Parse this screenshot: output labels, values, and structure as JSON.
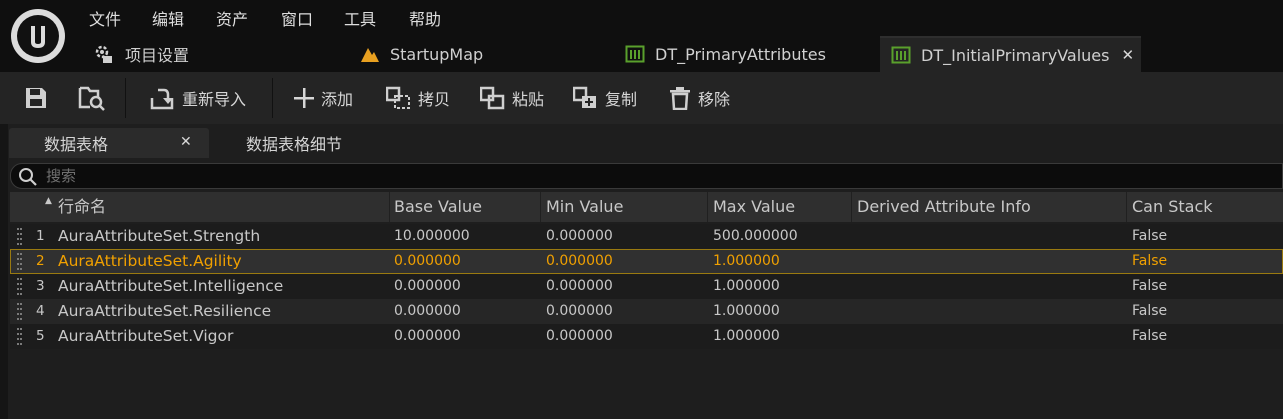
{
  "menubar": {
    "items": [
      "文件",
      "编辑",
      "资产",
      "窗口",
      "工具",
      "帮助"
    ]
  },
  "tabs": [
    {
      "label": "项目设置",
      "icon": "settings-gear-icon"
    },
    {
      "label": "StartupMap",
      "icon": "level-map-icon"
    },
    {
      "label": "DT_PrimaryAttributes",
      "icon": "data-table-icon"
    },
    {
      "label": "DT_InitialPrimaryValues",
      "icon": "data-table-icon",
      "active": true
    }
  ],
  "toolbar": {
    "save_icon": "save-icon",
    "browse_icon": "browse-asset-icon",
    "reimport_label": "重新导入",
    "add_label": "添加",
    "copy_label": "拷贝",
    "paste_label": "粘贴",
    "duplicate_label": "复制",
    "remove_label": "移除"
  },
  "panel_tabs": [
    {
      "label": "数据表格",
      "active": true
    },
    {
      "label": "数据表格细节"
    }
  ],
  "search": {
    "placeholder": "搜索",
    "value": ""
  },
  "table": {
    "columns": [
      "行命名",
      "Base Value",
      "Min Value",
      "Max Value",
      "Derived Attribute Info",
      "Can Stack"
    ],
    "rows": [
      {
        "index": "1",
        "name": "AuraAttributeSet.Strength",
        "base": "10.000000",
        "min": "0.000000",
        "max": "500.000000",
        "derived": "",
        "stack": "False"
      },
      {
        "index": "2",
        "name": "AuraAttributeSet.Agility",
        "base": "0.000000",
        "min": "0.000000",
        "max": "1.000000",
        "derived": "",
        "stack": "False",
        "selected": true
      },
      {
        "index": "3",
        "name": "AuraAttributeSet.Intelligence",
        "base": "0.000000",
        "min": "0.000000",
        "max": "1.000000",
        "derived": "",
        "stack": "False"
      },
      {
        "index": "4",
        "name": "AuraAttributeSet.Resilience",
        "base": "0.000000",
        "min": "0.000000",
        "max": "1.000000",
        "derived": "",
        "stack": "False"
      },
      {
        "index": "5",
        "name": "AuraAttributeSet.Vigor",
        "base": "0.000000",
        "min": "0.000000",
        "max": "1.000000",
        "derived": "",
        "stack": "False"
      }
    ]
  },
  "colors": {
    "selection_text": "#f0a000",
    "selection_border": "#9a7a10",
    "table_icon": "#5aa02c",
    "map_icon": "#e8a020"
  }
}
